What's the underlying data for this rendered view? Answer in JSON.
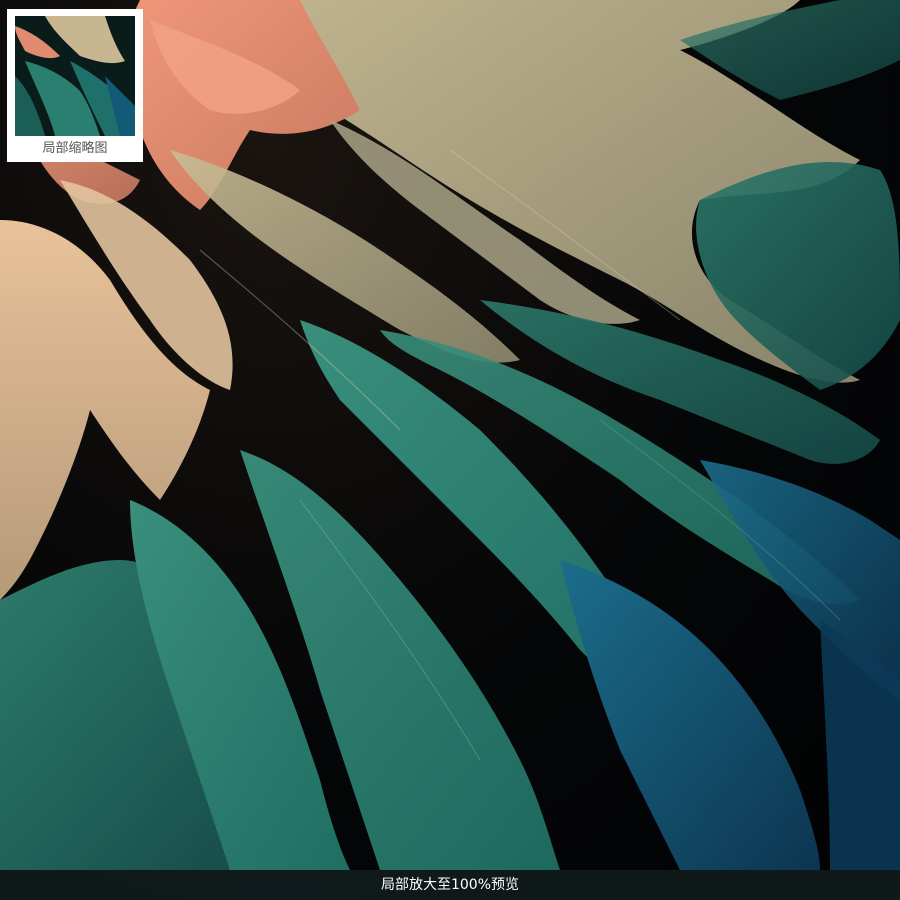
{
  "thumbnail": {
    "caption": "局部缩略图"
  },
  "footer": {
    "caption": "局部放大至100%预览"
  },
  "colors": {
    "background": "#020304",
    "salmon": "#e8876a",
    "peach": "#d9b48f",
    "sand": "#b7ad8c",
    "teal": "#2f8a78",
    "deep_teal": "#1e5f58",
    "blue": "#155d80",
    "footer_bg": "#141e20"
  },
  "image_subject": "fractal-flame-artwork"
}
